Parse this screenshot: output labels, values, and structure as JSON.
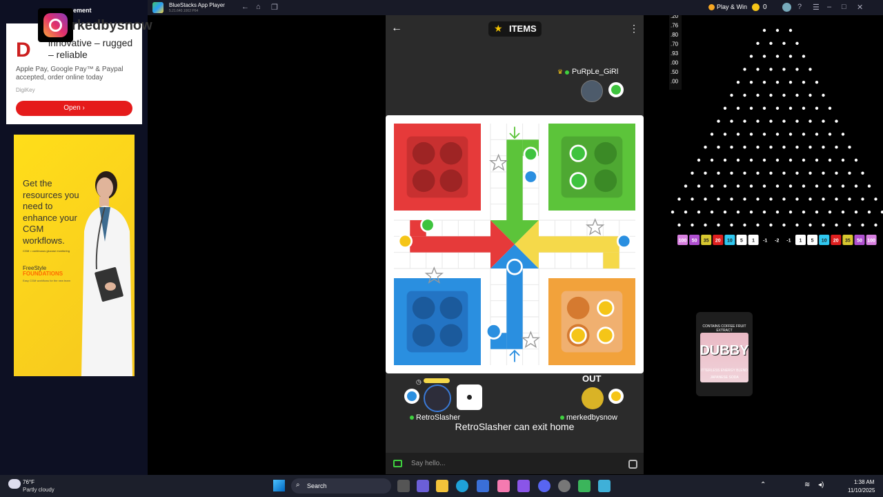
{
  "ads": {
    "top_label": "ement",
    "instagram_name": "instagram-logo",
    "watermark": "rkedbysnow",
    "digikey": {
      "logo": "D",
      "headline": "innovative – rugged – reliable",
      "body": "Apple Pay, Google Pay™ & Paypal accepted, order online today",
      "source": "DigiKey",
      "open_label": "Open"
    },
    "cgm": {
      "text": "Get the resources you need to enhance your CGM workflows.",
      "small": "CGM = continuous glucose monitoring",
      "brand1": "FreeStyle",
      "brand2": "FOUNDATIONS",
      "small2": "Easy CGM workflows for the new team"
    }
  },
  "titlebar": {
    "app_title": "BlueStacks App Player",
    "version": "5.21.640.1002  P64",
    "play_win": "Play & Win",
    "coins": "0"
  },
  "game": {
    "items_label": "ITEMS",
    "top_player": "PuRpLe_GiRl",
    "player_left": "RetroSlasher",
    "player_right": "merkedbysnow",
    "out_label": "OUT",
    "status": "RetroSlasher can exit home",
    "chat_placeholder": "Say hello..."
  },
  "plinko": {
    "multipliers": [
      ".20",
      ".76",
      ".80",
      ".70",
      ".93",
      ".00",
      ".50",
      ".00"
    ],
    "slots_left": [
      "100",
      "50",
      "35",
      "20",
      "10",
      "5",
      "1",
      "-1",
      "-2"
    ],
    "slots_right": [
      "-1",
      "1",
      "5",
      "10",
      "20",
      "35",
      "50",
      "100"
    ]
  },
  "sponsor": {
    "brand": "DUBBY",
    "top": "CONTAINS COFFEE FRUIT EXTRACT",
    "sub": "ITTERLESS ENERGY BLEND",
    "flavor": "JAPANESE SODA"
  },
  "taskbar": {
    "temperature": "76°F",
    "weather": "Partly cloudy",
    "search": "Search",
    "time": "1:38 AM",
    "date": "11/10/2025"
  }
}
